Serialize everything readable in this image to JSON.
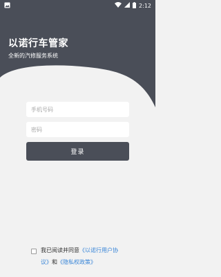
{
  "status_bar": {
    "time": "2:12"
  },
  "hero": {
    "title": "以诺行车管家",
    "subtitle": "全新的汽修服务系统"
  },
  "login": {
    "phone_placeholder": "手机号码",
    "password_placeholder": "密码",
    "submit_label": "登录"
  },
  "agreement": {
    "prefix": "我已阅读并同意",
    "user_agreement_a": "《以诺行用户协",
    "user_agreement_b": "议》",
    "conjunction": "和",
    "privacy_policy": "《隐私权政策》"
  },
  "colors": {
    "header_bg": "#4a4e58",
    "page_bg": "#f2f2f2",
    "button_bg": "#4a4e58",
    "link": "#3a86d8"
  }
}
